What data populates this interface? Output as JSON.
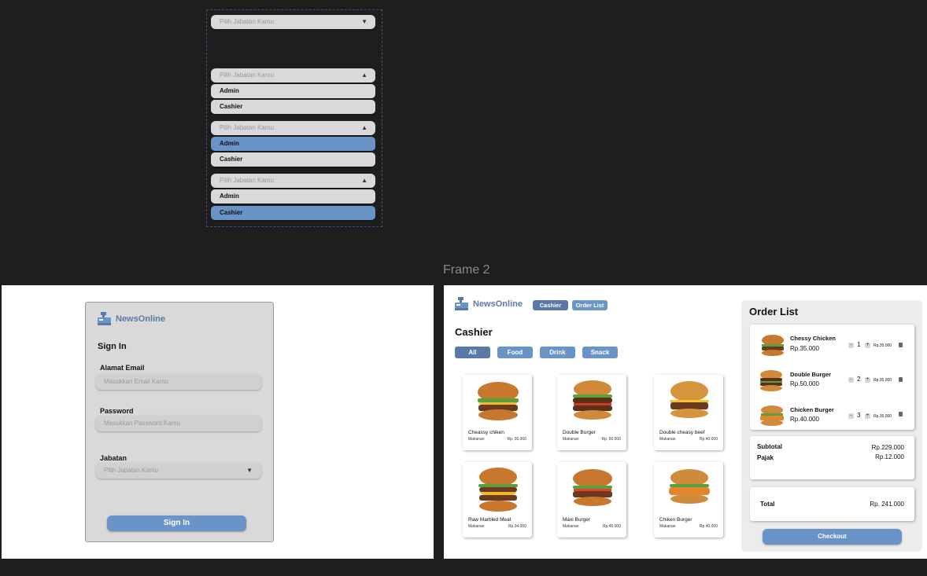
{
  "dropdowns": {
    "placeholder": "Pilih Jabatan Kamu",
    "caret_down": "▼",
    "caret_up": "▲",
    "options": [
      "Admin",
      "Cashier"
    ]
  },
  "frame_label": "Frame 2",
  "signin": {
    "brand": "NewsOnline",
    "title": "Sign In",
    "email_label": "Alamat Email",
    "email_placeholder": "Masukkan Email Kamu",
    "password_label": "Password",
    "password_placeholder": "Masukkan Password Kamu",
    "role_label": "Jabatan",
    "role_placeholder": "Pilih Jabatan Kamu",
    "button": "Sign In"
  },
  "cashier": {
    "brand": "NewsOnline",
    "nav": [
      "Cashier",
      "Order List"
    ],
    "title": "Cashier",
    "categories": [
      "All",
      "Food",
      "Drink",
      "Snack"
    ],
    "products": [
      {
        "name": "Cheassy chiken",
        "category": "Makanan",
        "price": "Rp. 35.000",
        "icon": "cheese-burger"
      },
      {
        "name": "Double Burger",
        "category": "Makanan",
        "price": "Rp. 50.000",
        "icon": "double-burger"
      },
      {
        "name": "Double cheasy beef",
        "category": "Makanan",
        "price": "Rp.40.000",
        "icon": "cheese-burger"
      },
      {
        "name": "Raw Marbled Meat",
        "category": "Makanan",
        "price": "Rp.34.000",
        "icon": "tall-burger"
      },
      {
        "name": "Maxi Burger",
        "category": "Makanan",
        "price": "Rp.45.000",
        "icon": "burger"
      },
      {
        "name": "Chiken Burger",
        "category": "Makanan",
        "price": "Rp.40.000",
        "icon": "chicken-burger"
      }
    ]
  },
  "order": {
    "title": "Order List",
    "items": [
      {
        "name": "Chessy Chicken",
        "price": "Rp.35.000",
        "qty": "1",
        "total": "Rp.35.000"
      },
      {
        "name": "Double Burger",
        "price": "Rp.50.000",
        "qty": "2",
        "total": "Rp.35.000"
      },
      {
        "name": "Chicken Burger",
        "price": "Rp.40.000",
        "qty": "3",
        "total": "Rp.35.000"
      }
    ],
    "minus": "-",
    "plus": "+",
    "subtotal_label": "Subtotal",
    "subtotal": "Rp.229.000",
    "tax_label": "Pajak",
    "tax": "Rp.12.000",
    "total_label": "Total",
    "total": "Rp. 241.000",
    "checkout": "Checkout"
  },
  "colors": {
    "accent": "#6a93c8",
    "accent_dark": "#5a78a8",
    "canvas": "#1e1e1e",
    "field": "#d9d9d9"
  }
}
